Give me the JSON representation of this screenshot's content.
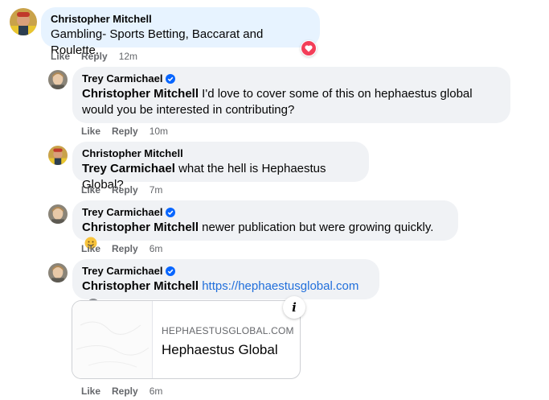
{
  "comments": [
    {
      "author": "Christopher Mitchell",
      "text": "Gambling- Sports Betting, Baccarat and Roulette.",
      "actions": {
        "like": "Like",
        "reply": "Reply",
        "time": "12m"
      },
      "reaction": "heart-icon"
    },
    {
      "author": "Trey Carmichael",
      "verified": true,
      "mention": "Christopher Mitchell",
      "text": " I'd love to cover some of this on hephaestus global",
      "text_line2": "would you be interested in contributing?",
      "actions": {
        "like": "Like",
        "reply": "Reply",
        "time": "10m"
      }
    },
    {
      "author": "Christopher Mitchell",
      "mention": "Trey Carmichael",
      "text": " what the hell is Hephaestus Global?",
      "actions": {
        "like": "Like",
        "reply": "Reply",
        "time": "7m"
      }
    },
    {
      "author": "Trey Carmichael",
      "verified": true,
      "mention": "Christopher Mitchell",
      "text": " newer publication but were growing quickly.",
      "emoji": "smile-emoji",
      "actions": {
        "like": "Like",
        "reply": "Reply",
        "time": "6m"
      }
    },
    {
      "author": "Trey Carmichael",
      "verified": true,
      "mention": "Christopher Mitchell",
      "link": "https://hephaestusglobal.com",
      "link_card": {
        "domain": "HEPHAESTUSGLOBAL.COM",
        "title": "Hephaestus Global",
        "info_symbol": "i"
      },
      "help_symbol": "?",
      "actions": {
        "like": "Like",
        "reply": "Reply",
        "time": "6m"
      }
    }
  ],
  "colors": {
    "bubble": "#f0f2f5",
    "highlight_bubble": "#e7f3ff",
    "link": "#216fdb",
    "verified": "#0866ff",
    "heart": "#f33e58",
    "secondary_text": "#65676b"
  }
}
